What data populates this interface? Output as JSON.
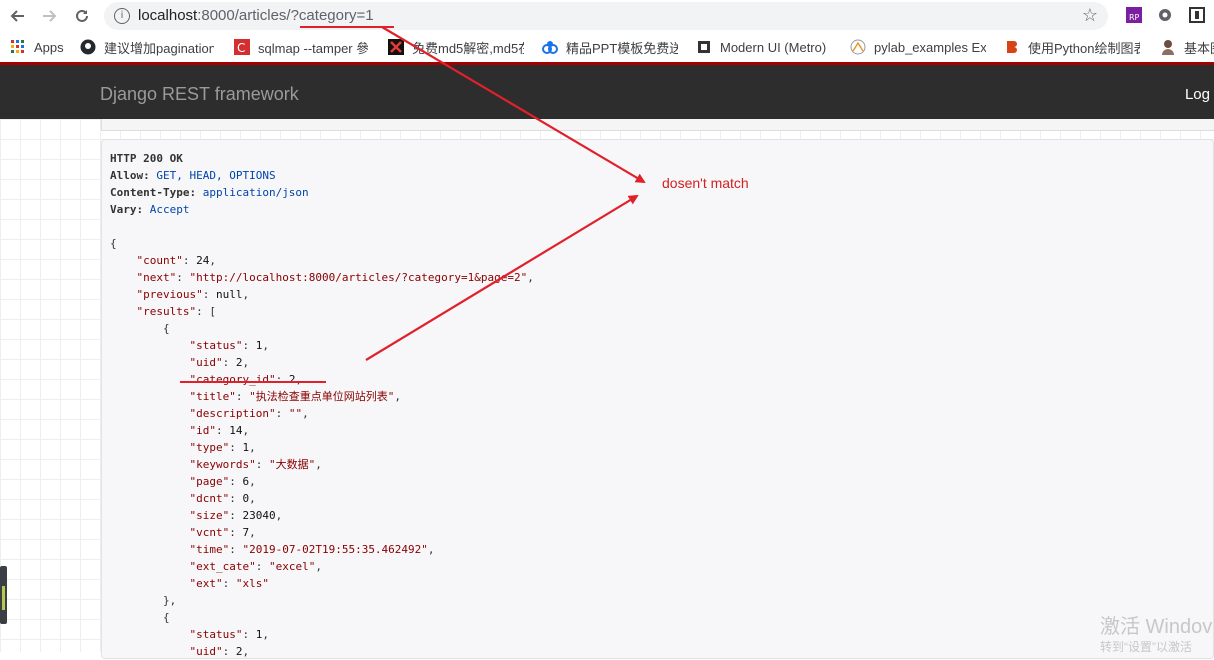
{
  "browser": {
    "url": "localhost:8000/articles/?category=1",
    "url_host": "localhost",
    "url_rest": ":8000/articles/?category=1",
    "bookmarks": [
      {
        "label": "Apps",
        "icon": "apps-grid-icon"
      },
      {
        "label": "建议增加pagination",
        "icon": "github-icon"
      },
      {
        "label": "sqlmap --tamper 參",
        "icon": "red-c-icon"
      },
      {
        "label": "免费md5解密,md5在",
        "icon": "red-x-icon"
      },
      {
        "label": "精品PPT模板免费送",
        "icon": "blue-link-icon"
      },
      {
        "label": "Modern UI (Metro)",
        "icon": "metro-icon"
      },
      {
        "label": "pylab_examples Exa",
        "icon": "plot-icon"
      },
      {
        "label": "使用Python绘制图表",
        "icon": "orange-b-icon"
      },
      {
        "label": "基本图",
        "icon": "person-icon"
      }
    ]
  },
  "navbar": {
    "brand": "Django REST framework",
    "login": "Log"
  },
  "response": {
    "status": "HTTP 200 OK",
    "headers": [
      {
        "key": "Allow:",
        "value": "GET, HEAD, OPTIONS"
      },
      {
        "key": "Content-Type:",
        "value": "application/json"
      },
      {
        "key": "Vary:",
        "value": "Accept"
      }
    ],
    "count": "24",
    "next": "\"http://localhost:8000/articles/?category=1&page=2\"",
    "previous": "null",
    "first_result": {
      "status": "1",
      "uid": "2",
      "category_id": "2",
      "title": "\"执法检查重点单位网站列表\"",
      "description": "\"\"",
      "id": "14",
      "type": "1",
      "keywords": "\"大数据\"",
      "page": "6",
      "dcnt": "0",
      "size": "23040",
      "vcnt": "7",
      "time": "\"2019-07-02T19:55:35.462492\"",
      "ext_cate": "\"excel\"",
      "ext": "\"xls\""
    },
    "second_result": {
      "status": "1",
      "uid": "2"
    }
  },
  "annotation": {
    "text": "dosen't match",
    "color": "#d41f1f"
  },
  "watermark": {
    "line1": "激活 Windov",
    "line2": "转到“设置”以激活"
  }
}
